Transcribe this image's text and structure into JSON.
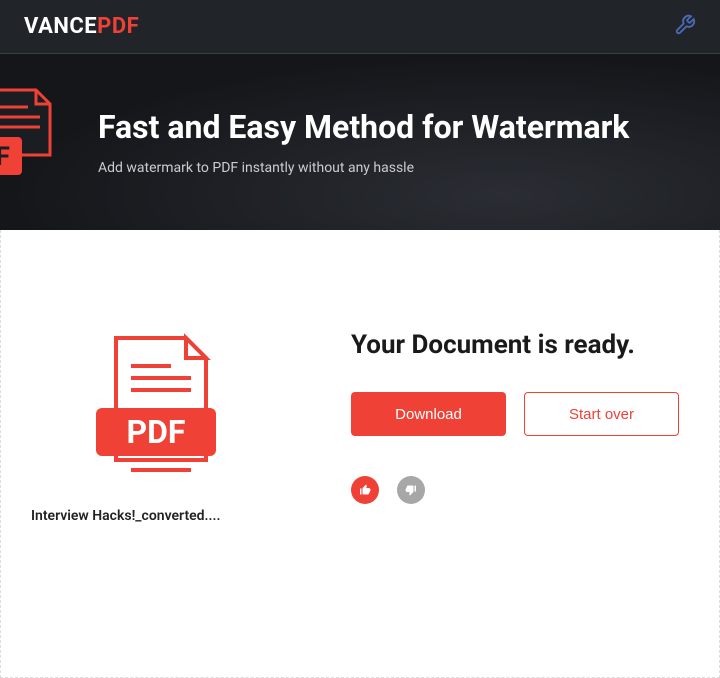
{
  "brand": {
    "part1": "VANCE",
    "part2": "PDF"
  },
  "hero": {
    "pdf_badge": "PDF",
    "title": "Fast and Easy Method for Watermark",
    "subtitle": "Add watermark to PDF instantly without any hassle"
  },
  "result": {
    "pdf_badge": "PDF",
    "filename": "Interview Hacks!_converted....",
    "ready_text": "Your Document is ready.",
    "download_label": "Download",
    "startover_label": "Start over"
  },
  "colors": {
    "accent": "#ef4136",
    "header": "#212529"
  }
}
